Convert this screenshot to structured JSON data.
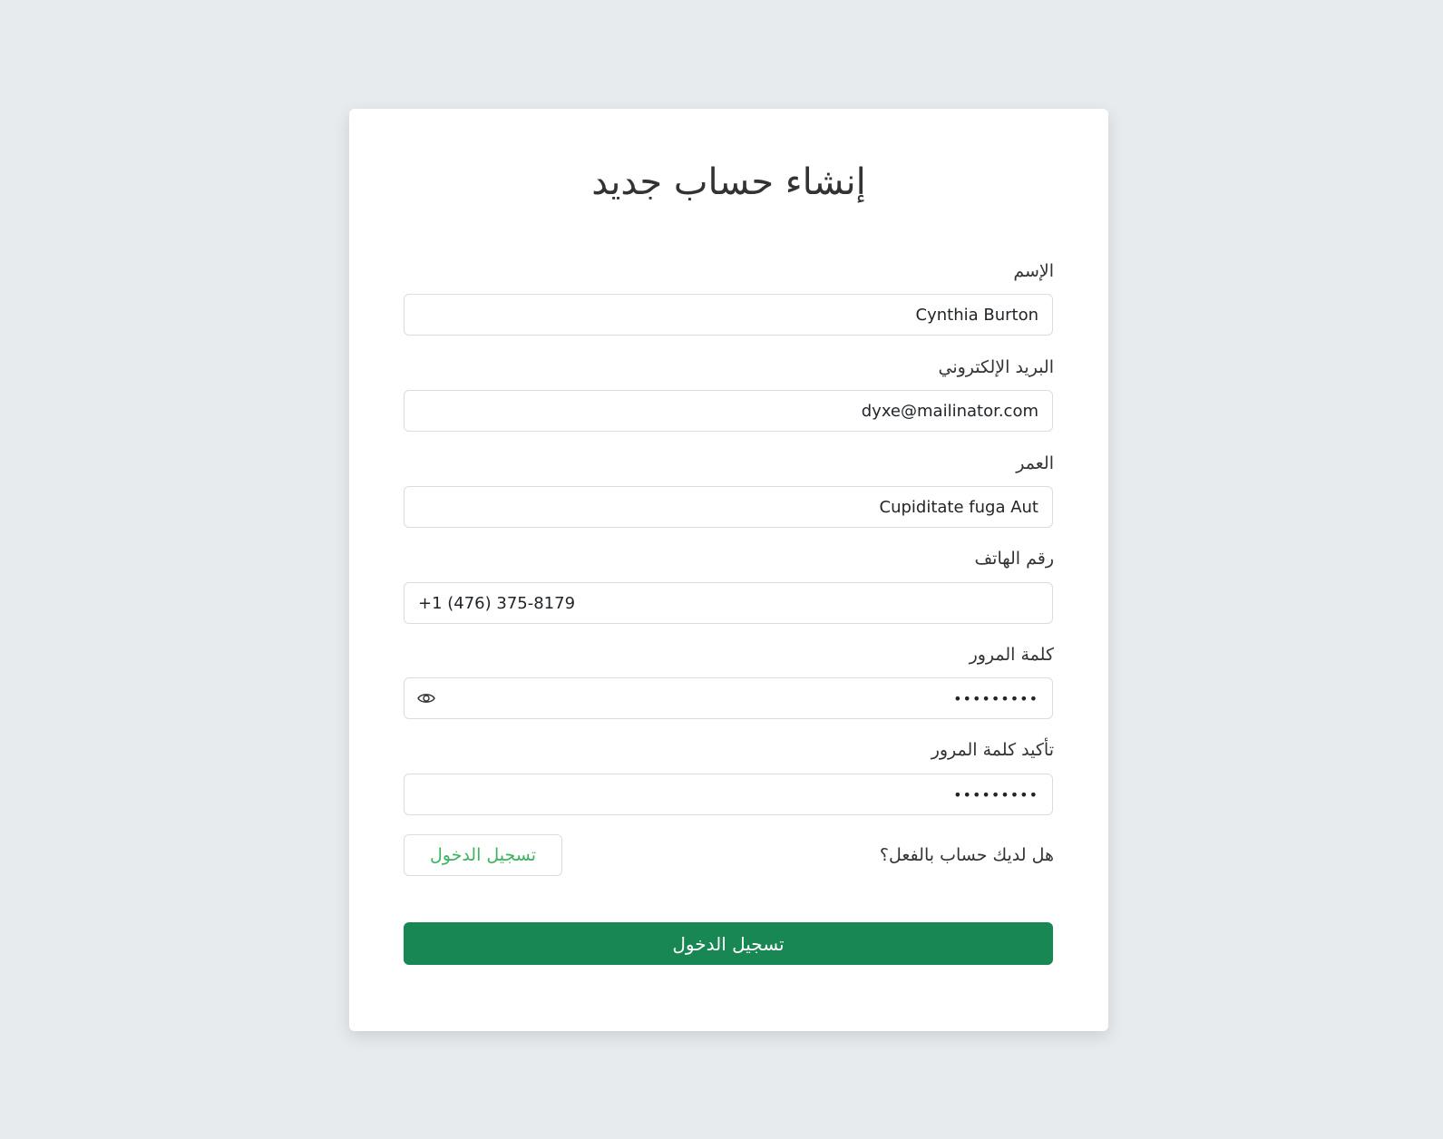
{
  "form": {
    "title": "إنشاء حساب جديد",
    "fields": {
      "name": {
        "label": "الإسم",
        "value": "Cynthia Burton"
      },
      "email": {
        "label": "البريد الإلكتروني",
        "value": "dyxe@mailinator.com"
      },
      "age": {
        "label": "العمر",
        "value": "Cupiditate fuga Aut"
      },
      "phone": {
        "label": "رقم الهاتف",
        "value": "+1 (476) 375-8179"
      },
      "password": {
        "label": "كلمة المرور",
        "value": "•••••••••"
      },
      "confirm_password": {
        "label": "تأكيد كلمة المرور",
        "value": "•••••••••"
      }
    },
    "have_account_text": "هل لديك حساب بالفعل؟",
    "login_link_label": "تسجيل الدخول",
    "submit_label": "تسجيل الدخول"
  },
  "icons": {
    "password_toggle": "eye-icon"
  },
  "colors": {
    "background": "#e7ebee",
    "primary": "#198754",
    "link_green": "#3cb35f"
  }
}
